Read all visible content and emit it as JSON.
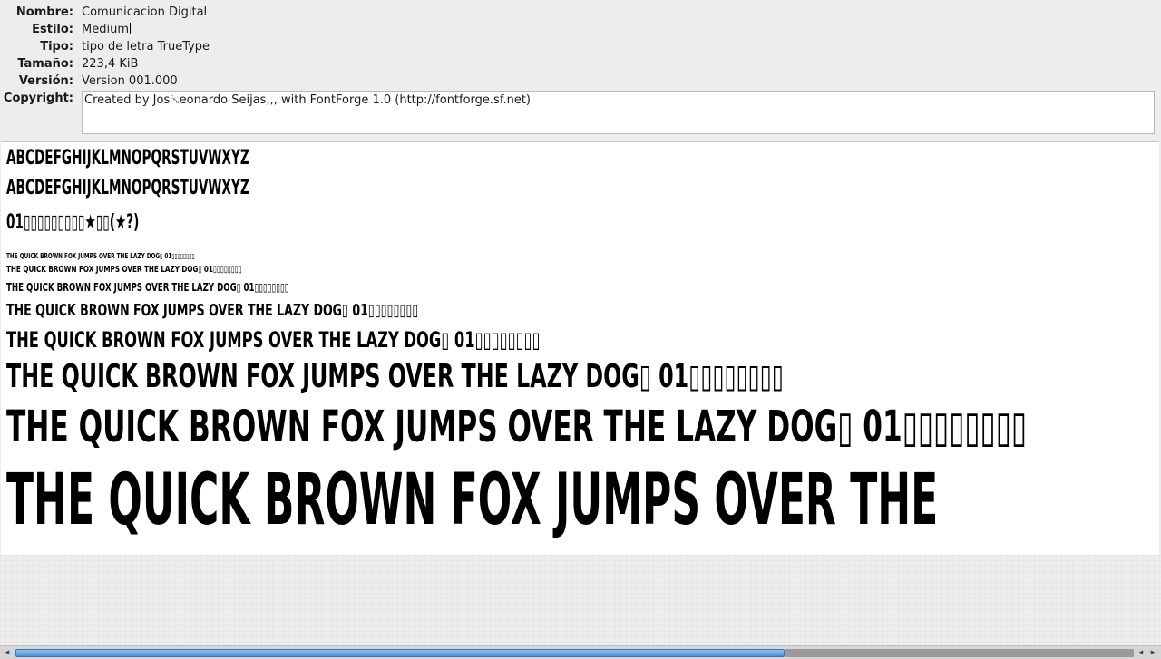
{
  "font_info": {
    "name_label": "Nombre:",
    "name_value": "Comunicacion Digital",
    "style_label": "Estilo:",
    "style_value": "Medium",
    "type_label": "Tipo:",
    "type_value": "tipo de letra TrueType",
    "size_label": "Tamaño:",
    "size_value": "223,4 KiB",
    "version_label": "Versión:",
    "version_value": "Version 001.000",
    "copyright_label": "Copyright:",
    "copyright_value": "Created by Jos␘eonardo Seijas,,, with FontForge 1.0 (http://fontforge.sf.net)"
  },
  "preview": {
    "uppercase": "ABCDEFGHIJKLMNOPQRSTUVWXYZ",
    "lowercase": "abcdefghijklmnopqrstuvwxyz",
    "digits": "01▯▯▯▯▯▯▯▯▯★▯▯(★?)",
    "sample": "THE QUICK BROWN FOX JUMPS OVER THE LAZY DOG▯ 01▯▯▯▯▯▯▯▯",
    "sample_large": "THE QUICK BROWN FOX JUMPS OVER THE"
  },
  "scrollbar": {
    "left_arrow": "◂",
    "right_arrow_1": "◂",
    "right_arrow_2": "▸",
    "position_fraction": 0.66
  }
}
